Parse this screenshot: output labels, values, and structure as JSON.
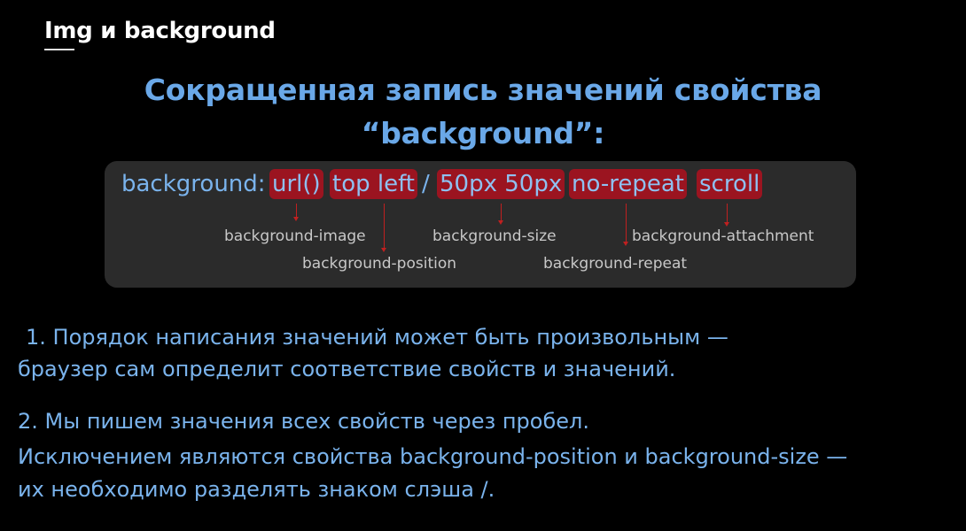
{
  "slide": {
    "top_title": "Img и background",
    "heading_line1": "Сокращенная запись значений свойства",
    "heading_line2": "“background”:"
  },
  "syntax": {
    "property": "background:",
    "separator": "/",
    "tokens": {
      "url": "url()",
      "position": "top left",
      "size": "50px 50px",
      "repeat": "no-repeat",
      "attachment": "scroll"
    },
    "captions": {
      "image": "background-image",
      "position": "background-position",
      "size": "background-size",
      "repeat": "background-repeat",
      "attachment": "background-attachment"
    },
    "colors": {
      "token_highlight": "#9b1420",
      "arrow": "#c02020",
      "text_blue": "#7ab3ec",
      "panel": "#2b2b2b"
    }
  },
  "notes": {
    "n1_line1": "1. Порядок написания значений может быть произвольным —",
    "n1_line2": "браузер сам определит соответствие свойств и значений.",
    "n2_line1": "2. Мы пишем значения всех свойств через пробел.",
    "n2_line2": "Исключением являются свойства background-position и background-size —",
    "n2_line3": "их необходимо разделять знаком слэша /."
  }
}
